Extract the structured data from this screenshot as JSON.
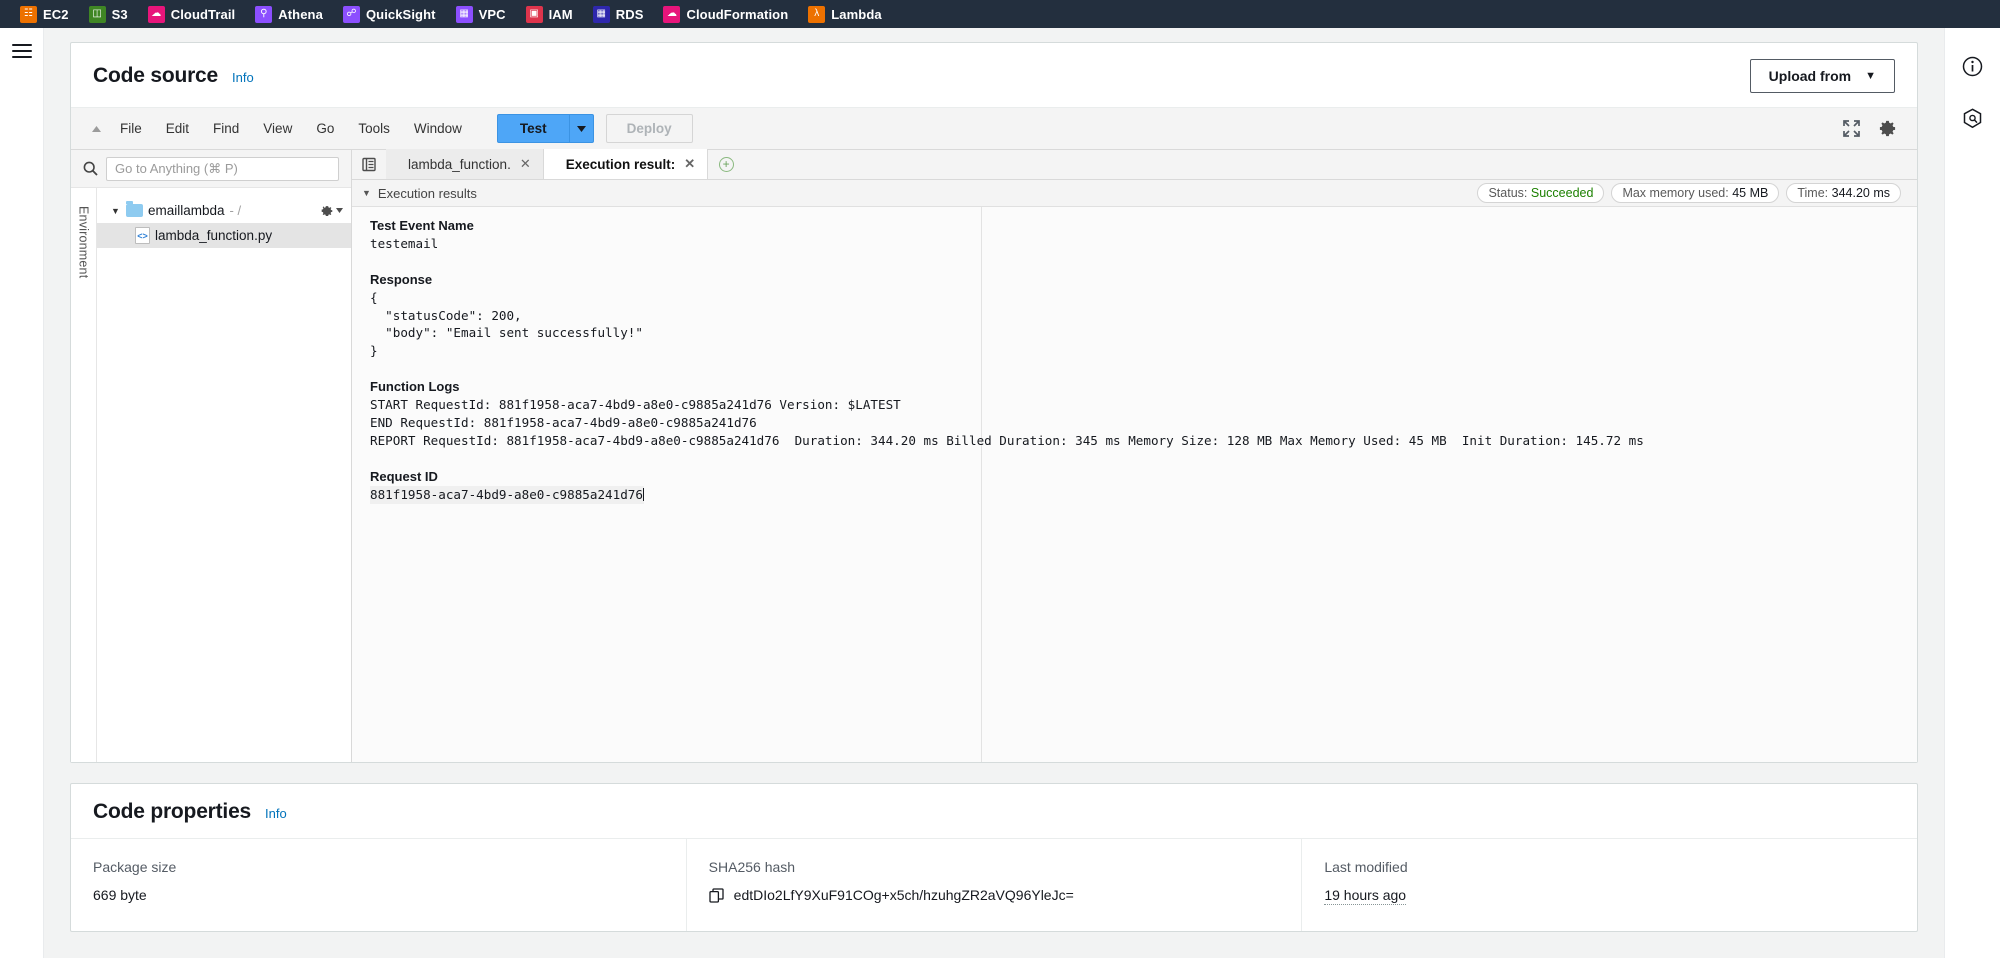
{
  "aws_nav": {
    "services": [
      {
        "name": "EC2",
        "icon": "ec2-icon",
        "color": "#ed7100"
      },
      {
        "name": "S3",
        "icon": "s3-icon",
        "color": "#3f8624"
      },
      {
        "name": "CloudTrail",
        "icon": "cloudtrail-icon",
        "color": "#e7157b"
      },
      {
        "name": "Athena",
        "icon": "athena-icon",
        "color": "#8c4fff"
      },
      {
        "name": "QuickSight",
        "icon": "quicksight-icon",
        "color": "#8c4fff"
      },
      {
        "name": "VPC",
        "icon": "vpc-icon",
        "color": "#8c4fff"
      },
      {
        "name": "IAM",
        "icon": "iam-icon",
        "color": "#dd344c"
      },
      {
        "name": "RDS",
        "icon": "rds-icon",
        "color": "#2e27ad"
      },
      {
        "name": "CloudFormation",
        "icon": "cloudformation-icon",
        "color": "#e7157b"
      },
      {
        "name": "Lambda",
        "icon": "lambda-icon",
        "color": "#ed7100"
      }
    ]
  },
  "code_source": {
    "title": "Code source",
    "info_label": "Info",
    "upload_button": "Upload from",
    "menu": [
      "File",
      "Edit",
      "Find",
      "View",
      "Go",
      "Tools",
      "Window"
    ],
    "test_button": "Test",
    "deploy_button": "Deploy"
  },
  "file_panel": {
    "search_placeholder": "Go to Anything (⌘ P)",
    "environment_label": "Environment",
    "folder": "emaillambda",
    "folder_path": "- /",
    "file": "lambda_function.py"
  },
  "editor": {
    "tabs": [
      {
        "label": "lambda_function.",
        "active": false
      },
      {
        "label": "Execution result:",
        "active": true
      }
    ],
    "exec_header": "Execution results",
    "badges": {
      "status_label": "Status:",
      "status_value": "Succeeded",
      "memory_label": "Max memory used:",
      "memory_value": "45 MB",
      "time_label": "Time:",
      "time_value": "344.20 ms"
    }
  },
  "execution_results": {
    "test_event_name_label": "Test Event Name",
    "test_event_name_value": "testemail",
    "response_label": "Response",
    "response_body": "{\n  \"statusCode\": 200,\n  \"body\": \"Email sent successfully!\"\n}",
    "function_logs_label": "Function Logs",
    "log_start": "START RequestId: 881f1958-aca7-4bd9-a8e0-c9885a241d76 Version: $LATEST",
    "log_end": "END RequestId: 881f1958-aca7-4bd9-a8e0-c9885a241d76",
    "log_report": "REPORT RequestId: 881f1958-aca7-4bd9-a8e0-c9885a241d76  Duration: 344.20 ms Billed Duration: 345 ms Memory Size: 128 MB Max Memory Used: 45 MB  Init Duration: 145.72 ms",
    "request_id_label": "Request ID",
    "request_id_value": "881f1958-aca7-4bd9-a8e0-c9885a241d76"
  },
  "code_properties": {
    "title": "Code properties",
    "info_label": "Info",
    "columns": [
      {
        "key": "Package size",
        "value": "669 byte"
      },
      {
        "key": "SHA256 hash",
        "value": "edtDIo2LfY9XuF91COg+x5ch/hzuhgZR2aVQ96YleJc="
      },
      {
        "key": "Last modified",
        "value": "19 hours ago"
      }
    ]
  }
}
